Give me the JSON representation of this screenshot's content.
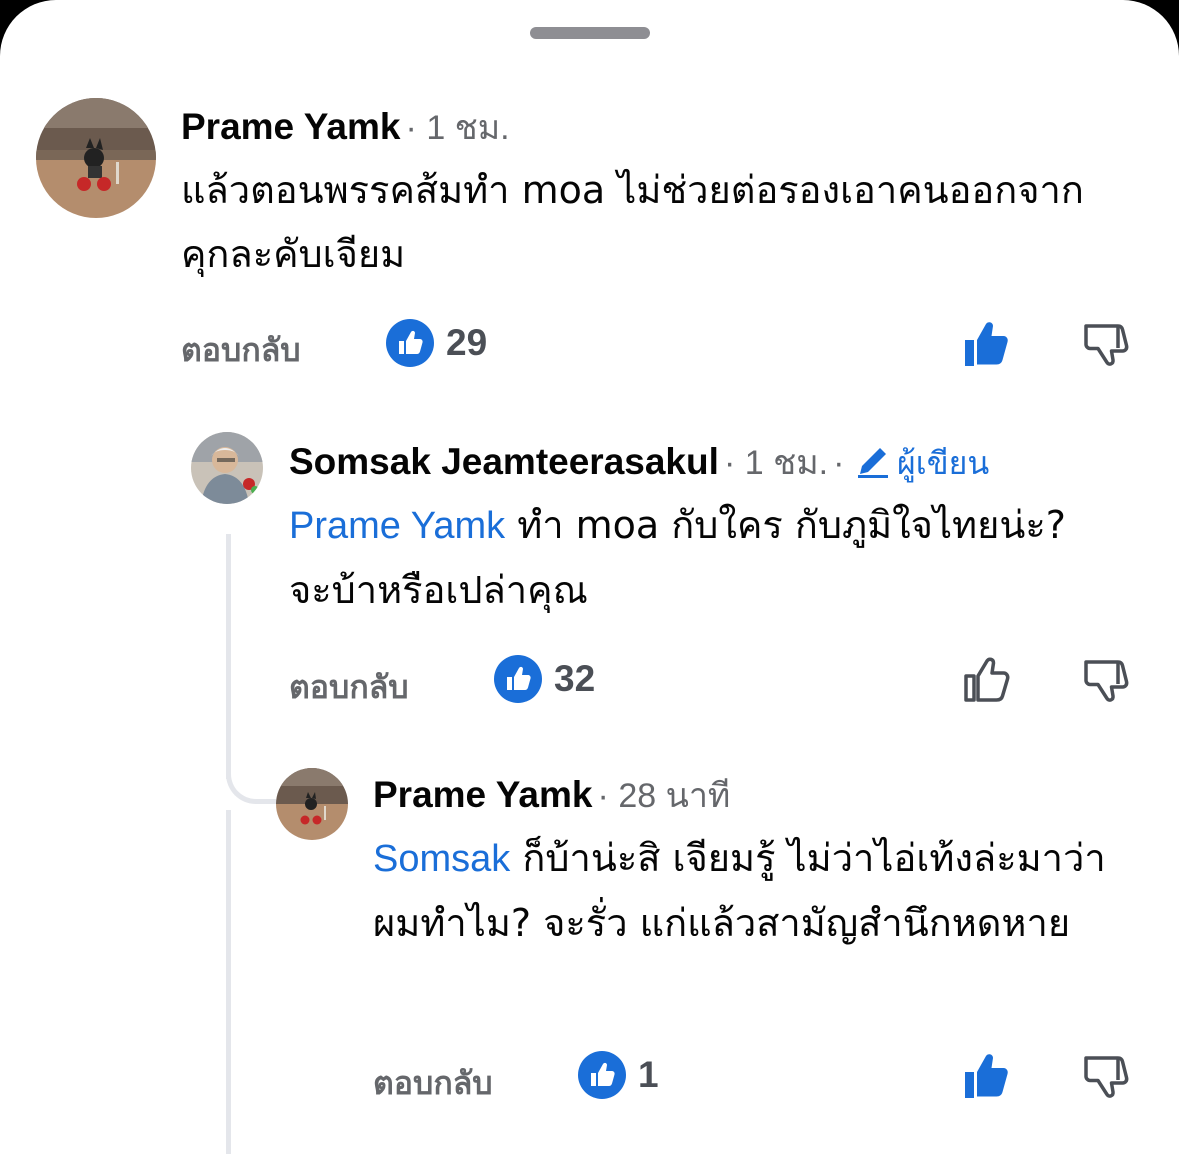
{
  "colors": {
    "link": "#1a6ed8",
    "like_badge": "#1a6ed8",
    "muted": "#65676b"
  },
  "comments": [
    {
      "author": "Prame Yamk",
      "time": "1 ชม.",
      "mention": "",
      "text": "แล้วตอนพรรคส้มทำ moa ไม่ช่วยต่อรองเอาคนออกจากคุกละคับเจียม",
      "reply_label": "ตอบกลับ",
      "like_count": "29",
      "liked": true
    },
    {
      "author": "Somsak Jeamteerasakul",
      "time": "1 ชม.",
      "author_badge": "ผู้เขียน",
      "mention": "Prame Yamk",
      "text": "ทำ moa กับใคร กับภูมิใจไทยน่ะ? จะบ้าหรือเปล่าคุณ",
      "reply_label": "ตอบกลับ",
      "like_count": "32",
      "liked": false
    },
    {
      "author": "Prame Yamk",
      "time": "28 นาที",
      "mention": "Somsak",
      "text": "ก็บ้าน่ะสิ เจียมรู้ ไม่ว่าไอ่เท้งล่ะมาว่าผมทำไม? จะรั่ว แก่แล้วสามัญสำนึกหดหาย",
      "reply_label": "ตอบกลับ",
      "like_count": "1",
      "liked": true
    }
  ],
  "icons": {
    "grabber": "sheet-grabber",
    "like_badge": "thumbs-up-badge-icon",
    "upvote": "thumbs-up-icon",
    "downvote": "thumbs-down-icon",
    "author_badge": "pencil-icon"
  }
}
